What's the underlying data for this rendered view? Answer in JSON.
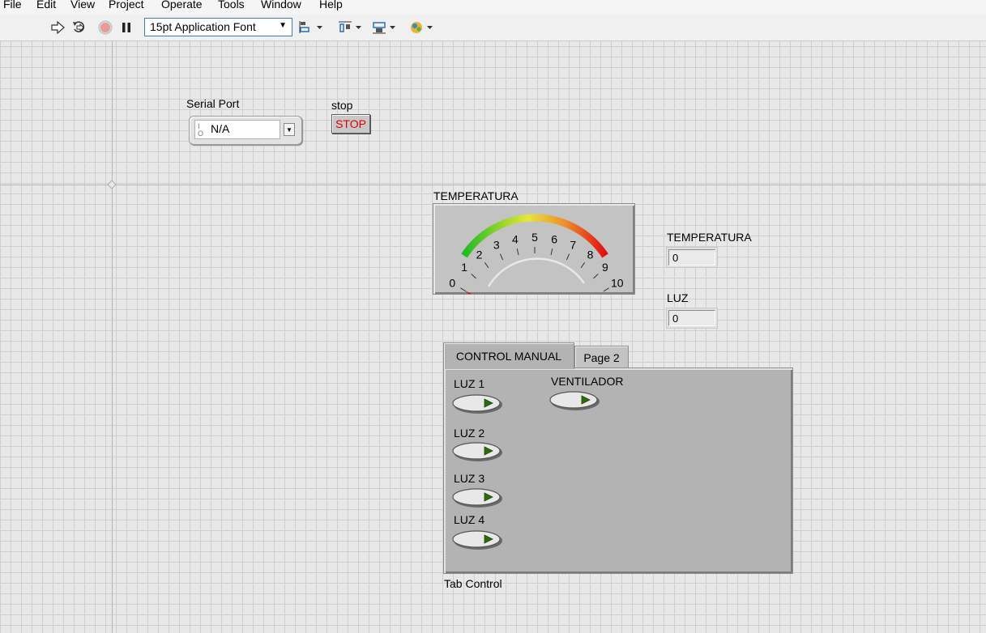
{
  "menu": [
    "File",
    "Edit",
    "View",
    "Project",
    "Operate",
    "Tools",
    "Window",
    "Help"
  ],
  "toolbar": {
    "font": "15pt Application Font",
    "icons": [
      "run-arrow-icon",
      "run-continuously-icon",
      "abort-icon",
      "pause-icon",
      "align-objects-icon",
      "distribute-objects-icon",
      "resize-objects-icon",
      "reorder-icon"
    ]
  },
  "serial_port": {
    "label": "Serial Port",
    "value": "N/A"
  },
  "stop": {
    "label": "stop",
    "button": "STOP"
  },
  "gauge": {
    "label": "TEMPERATURA",
    "ticks": [
      "0",
      "1",
      "2",
      "3",
      "4",
      "5",
      "6",
      "7",
      "8",
      "9",
      "10"
    ],
    "value": 0
  },
  "indicators": [
    {
      "label": "TEMPERATURA",
      "value": "0"
    },
    {
      "label": "LUZ",
      "value": "0"
    }
  ],
  "tab_control": {
    "label": "Tab Control",
    "tabs": [
      "CONTROL MANUAL",
      "Page 2"
    ],
    "active_tab": 0,
    "buttons": [
      "LUZ 1",
      "LUZ 2",
      "LUZ 3",
      "LUZ 4",
      "VENTILADOR"
    ]
  },
  "colors": {
    "stop_text": "#e00000",
    "led_off": "#2e6b0c",
    "gauge_needle": "#e00000"
  }
}
